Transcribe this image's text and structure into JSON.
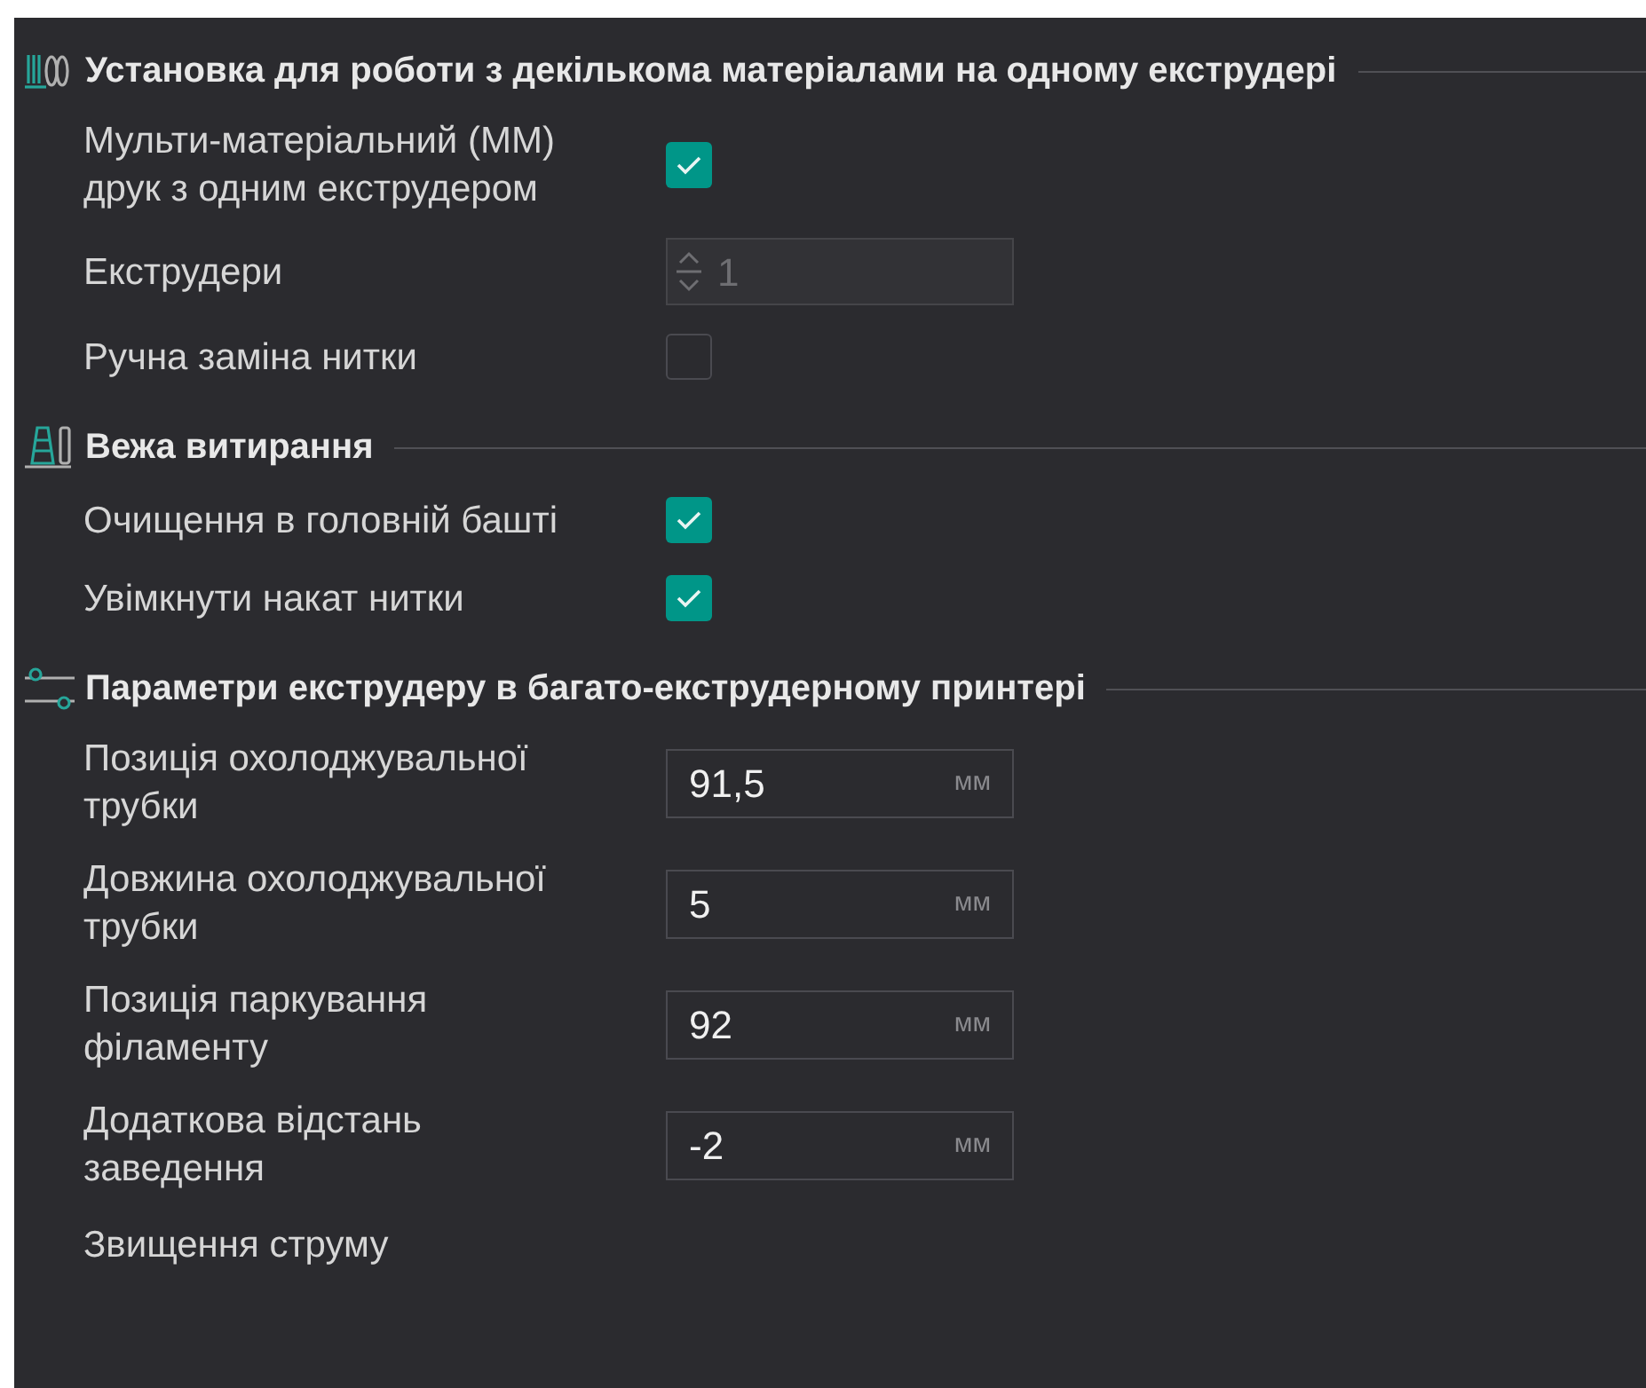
{
  "sections": [
    {
      "title": "Установка для роботи з декількома матеріалами на одному екструдері",
      "items": [
        {
          "kind": "checkbox",
          "label": "Мульти-матеріальний (ММ) друк з одним екструдером",
          "checked": true
        },
        {
          "kind": "spin",
          "label": "Екструдери",
          "value": "1",
          "disabled": true
        },
        {
          "kind": "checkbox",
          "label": "Ручна заміна нитки",
          "checked": false
        }
      ]
    },
    {
      "title": "Вежа витирання",
      "items": [
        {
          "kind": "checkbox",
          "label": "Очищення в головній башті",
          "checked": true
        },
        {
          "kind": "checkbox",
          "label": "Увімкнути накат нитки",
          "checked": true
        }
      ]
    },
    {
      "title": "Параметри екструдеру в багато-екструдерному принтері",
      "items": [
        {
          "kind": "number",
          "label": "Позиція охолоджувальної трубки",
          "value": "91,5",
          "unit": "мм"
        },
        {
          "kind": "number",
          "label": "Довжина охолоджувальної трубки",
          "value": "5",
          "unit": "мм"
        },
        {
          "kind": "number",
          "label": "Позиція паркування філаменту",
          "value": "92",
          "unit": "мм"
        },
        {
          "kind": "number",
          "label": "Додаткова відстань заведення",
          "value": "-2",
          "unit": "мм"
        },
        {
          "kind": "text",
          "label": "Звищення струму"
        }
      ]
    }
  ]
}
